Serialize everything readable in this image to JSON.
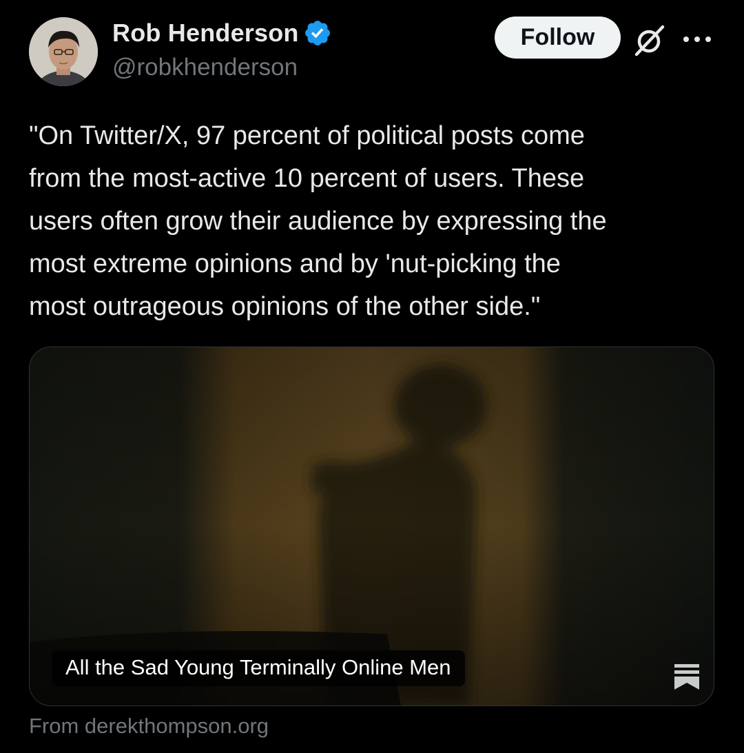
{
  "author": {
    "display_name": "Rob Henderson",
    "handle": "@robkhenderson",
    "verified": true,
    "verified_color": "#1d9bf0"
  },
  "actions": {
    "follow_label": "Follow",
    "grok_icon": "grok-slash-icon",
    "more_icon": "more-dots-icon"
  },
  "tweet": {
    "text": "\"On Twitter/X, 97 percent of political posts come\nfrom the most-active 10 percent of users. These\nusers often grow their audience by expressing the\nmost extreme opinions and by 'nut-picking the\nmost outrageous opinions of the other side.\""
  },
  "link_card": {
    "title": "All the Sad Young Terminally Online Men",
    "source_icon": "substack-icon",
    "image_description_icon": "shadow-silhouette-image"
  },
  "source": {
    "text": "From derekthompson.org"
  },
  "colors": {
    "background": "#000000",
    "primary_text": "#e7e9ea",
    "secondary_text": "#71767b",
    "follow_bg": "#eff3f4",
    "card_border": "#2f3336"
  }
}
